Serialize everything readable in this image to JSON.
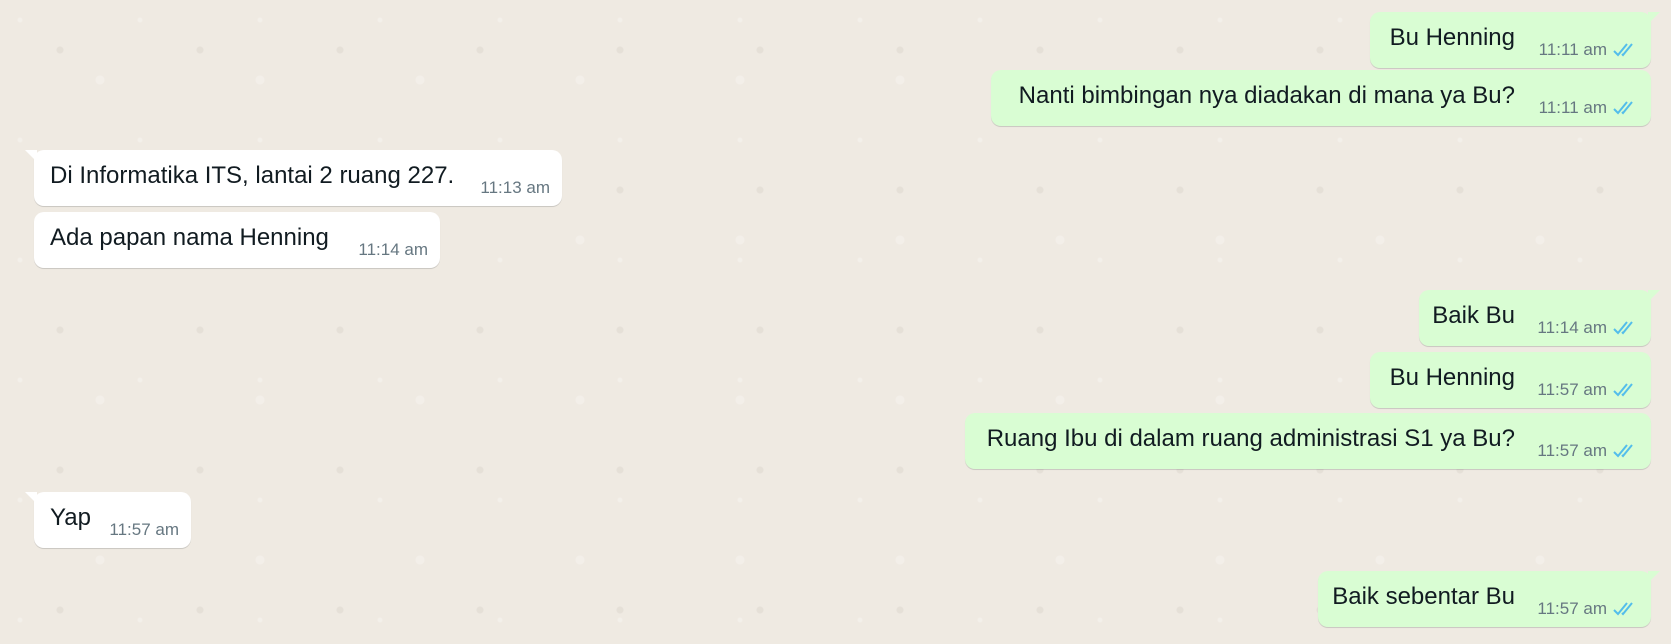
{
  "colors": {
    "chat_background": "#efeae2",
    "outgoing_bubble": "#d9fdd3",
    "incoming_bubble": "#ffffff",
    "read_tick": "#53bdeb",
    "time_text": "#667781"
  },
  "messages": [
    {
      "direction": "outgoing",
      "text": "Bu Henning",
      "time": "11:11 am",
      "status": "read",
      "icon": "double-check-icon"
    },
    {
      "direction": "outgoing",
      "text": "Nanti bimbingan nya diadakan di mana ya Bu?",
      "time": "11:11 am",
      "status": "read",
      "icon": "double-check-icon"
    },
    {
      "direction": "incoming",
      "text": "Di Informatika ITS, lantai 2 ruang 227.",
      "time": "11:13 am"
    },
    {
      "direction": "incoming",
      "text": "Ada papan nama Henning",
      "time": "11:14 am"
    },
    {
      "direction": "outgoing",
      "text": "Baik Bu",
      "time": "11:14 am",
      "status": "read",
      "icon": "double-check-icon"
    },
    {
      "direction": "outgoing",
      "text": "Bu Henning",
      "time": "11:57 am",
      "status": "read",
      "icon": "double-check-icon"
    },
    {
      "direction": "outgoing",
      "text": "Ruang Ibu di dalam ruang administrasi S1 ya Bu?",
      "time": "11:57 am",
      "status": "read",
      "icon": "double-check-icon"
    },
    {
      "direction": "incoming",
      "text": "Yap",
      "time": "11:57 am"
    },
    {
      "direction": "outgoing",
      "text": "Baik sebentar Bu",
      "time": "11:57 am",
      "status": "read",
      "icon": "double-check-icon"
    }
  ]
}
